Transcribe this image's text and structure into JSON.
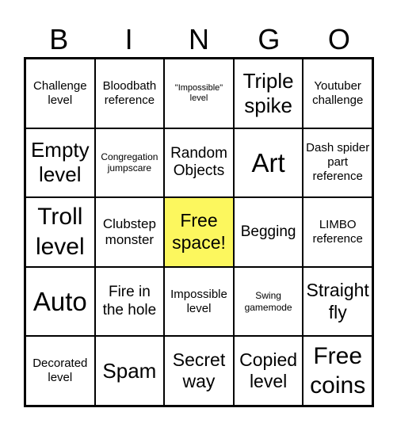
{
  "header": [
    "B",
    "I",
    "N",
    "G",
    "O"
  ],
  "cells": [
    "Challenge level",
    "Bloodbath reference",
    "\"Impossible\" level",
    "Triple spike",
    "Youtuber challenge",
    "Empty level",
    "Congregation jumpscare",
    "Random Objects",
    "Art",
    "Dash spider part reference",
    "Troll level",
    "Clubstep monster",
    "Free space!",
    "Begging",
    "LIMBO reference",
    "Auto",
    "Fire in the hole",
    "Impossible level",
    "Swing gamemode",
    "Straight fly",
    "Decorated level",
    "Spam",
    "Secret way",
    "Copied level",
    "Free coins"
  ],
  "colors": {
    "free_space": "#fcf75e",
    "border": "#000000"
  }
}
